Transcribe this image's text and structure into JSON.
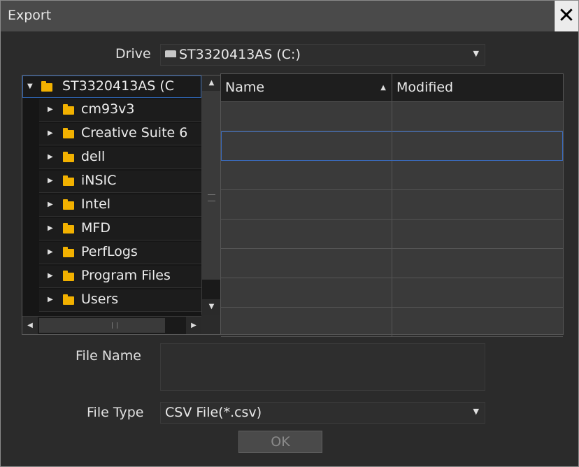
{
  "window": {
    "title": "Export",
    "close_symbol": "✕"
  },
  "drive": {
    "label": "Drive",
    "value": "ST3320413AS (C:)",
    "icon": "drive-icon"
  },
  "tree": {
    "root": {
      "label": "ST3320413AS (C",
      "expanded": true
    },
    "items": [
      {
        "label": "cm93v3"
      },
      {
        "label": "Creative Suite 6"
      },
      {
        "label": "dell"
      },
      {
        "label": "iNSIC"
      },
      {
        "label": "Intel"
      },
      {
        "label": "MFD"
      },
      {
        "label": "PerfLogs"
      },
      {
        "label": "Program Files"
      },
      {
        "label": "Users"
      }
    ]
  },
  "grid": {
    "columns": [
      "Name",
      "Modified"
    ],
    "sorted_column": "Name",
    "rows": [
      {
        "name": "",
        "modified": ""
      },
      {
        "name": "",
        "modified": "",
        "selected": true
      },
      {
        "name": "",
        "modified": ""
      },
      {
        "name": "",
        "modified": ""
      },
      {
        "name": "",
        "modified": ""
      },
      {
        "name": "",
        "modified": ""
      },
      {
        "name": "",
        "modified": ""
      },
      {
        "name": "",
        "modified": ""
      }
    ]
  },
  "file_name": {
    "label": "File Name",
    "value": ""
  },
  "file_type": {
    "label": "File Type",
    "value": "CSV File(*.csv)"
  },
  "ok_button": {
    "label": "OK",
    "enabled": false
  }
}
